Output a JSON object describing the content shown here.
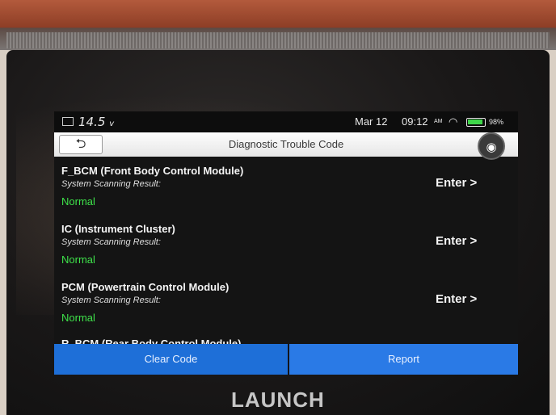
{
  "status_bar": {
    "voltage": "14.5",
    "voltage_unit": "v",
    "date": "Mar 12",
    "time": "09:12",
    "ampm": "AM",
    "battery_percent": "98%",
    "icons": [
      "vehicle-battery-icon",
      "wifi-icon",
      "battery-icon"
    ]
  },
  "header": {
    "back_icon": "⮌",
    "title": "Diagnostic Trouble Code",
    "camera_icon": "◉"
  },
  "modules": [
    {
      "name": "F_BCM (Front Body Control Module)",
      "result_label": "System Scanning Result:",
      "result": "Normal",
      "action": "Enter >"
    },
    {
      "name": "IC (Instrument Cluster)",
      "result_label": "System Scanning Result:",
      "result": "Normal",
      "action": "Enter >"
    },
    {
      "name": "PCM (Powertrain Control Module)",
      "result_label": "System Scanning Result:",
      "result": "Normal",
      "action": "Enter >"
    },
    {
      "name": "R_BCM (Rear Body Control Module)"
    }
  ],
  "footer": {
    "clear_label": "Clear Code",
    "report_label": "Report"
  },
  "brand": "LAUNCH",
  "colors": {
    "status_normal": "#3ee24a",
    "button_blue": "#1e6fd8"
  }
}
